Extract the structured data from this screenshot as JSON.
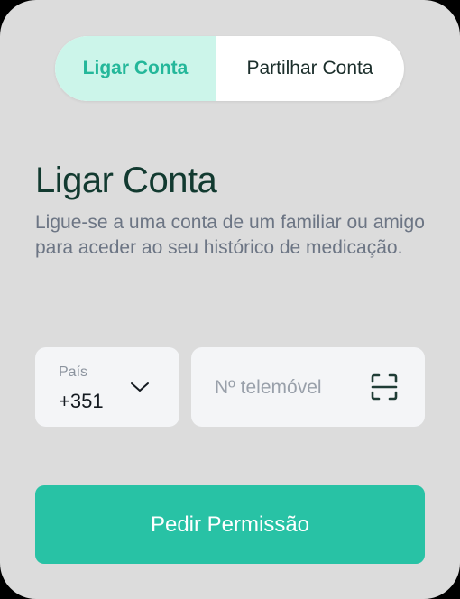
{
  "tabs": {
    "active_label": "Ligar Conta",
    "inactive_label": "Partilhar Conta"
  },
  "title": "Ligar Conta",
  "subtitle": "Ligue-se a uma conta de um familiar ou amigo para aceder ao seu histórico de medicação.",
  "country": {
    "label": "País",
    "value": "+351",
    "icon": "chevron-down-icon"
  },
  "phone": {
    "placeholder": "Nº telemóvel",
    "icon": "scan-icon"
  },
  "submit_label": "Pedir Permissão",
  "colors": {
    "accent": "#28c2a5",
    "accent_light": "#ccf5ea",
    "title": "#123a30",
    "background": "#dcdcdc"
  }
}
